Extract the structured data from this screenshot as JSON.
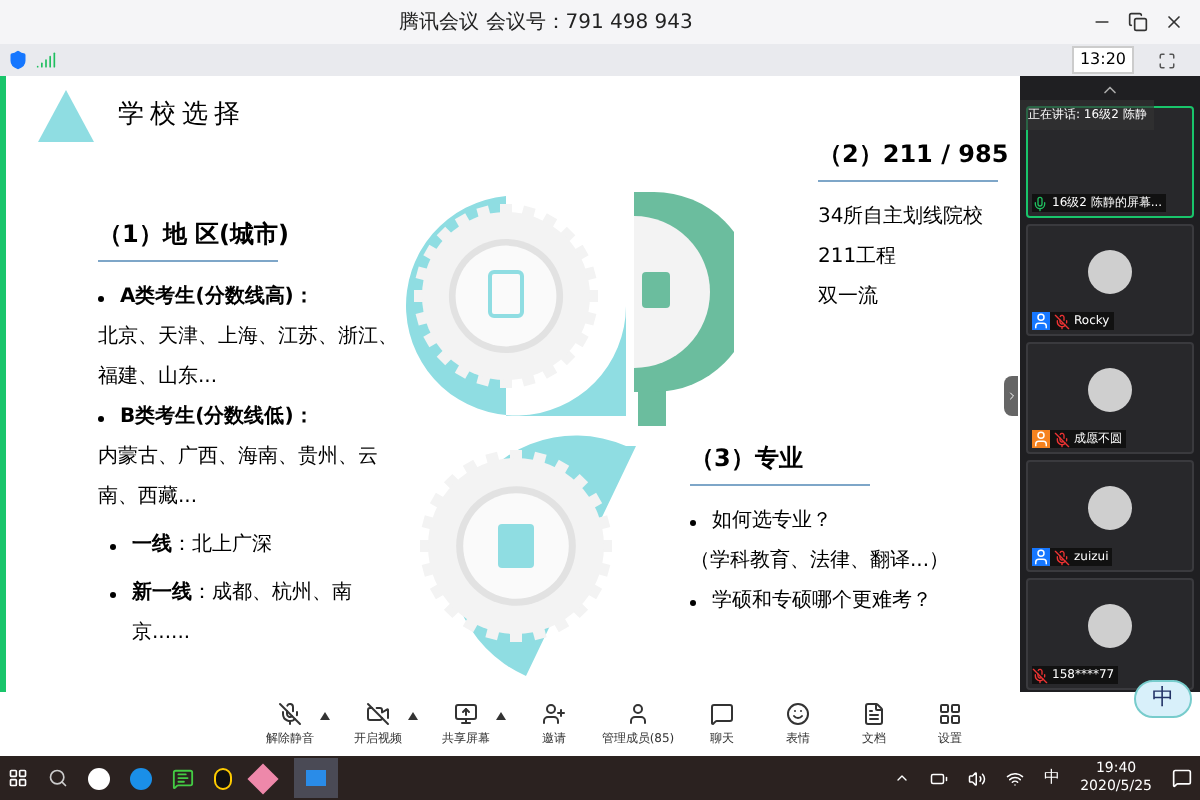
{
  "window": {
    "title": "腾讯会议 会议号：791 498 943",
    "timer": "13:20"
  },
  "slide": {
    "title": "学校选择",
    "sections": [
      {
        "heading": "（1）地 区(城市)",
        "items": [
          {
            "kind": "bullet",
            "text": "**A类考生(分数线高)：**"
          },
          {
            "kind": "line",
            "text": "北京、天津、上海、江苏、浙江、福建、山东..."
          },
          {
            "kind": "bullet",
            "text": "**B类考生(分数线低)：**"
          },
          {
            "kind": "line",
            "text": "内蒙古、广西、海南、贵州、云南、西藏..."
          },
          {
            "kind": "sub",
            "text": "**一线**：北上广深"
          },
          {
            "kind": "sub",
            "text": "**新一线**：成都、杭州、南京......"
          }
        ]
      },
      {
        "heading": "（2）211 / 985",
        "items": [
          {
            "kind": "line",
            "text": "34所自主划线院校"
          },
          {
            "kind": "line",
            "text": "211工程"
          },
          {
            "kind": "line",
            "text": "双一流"
          }
        ]
      },
      {
        "heading": "（3）专业",
        "items": [
          {
            "kind": "bullet",
            "text": "如何选专业？"
          },
          {
            "kind": "line",
            "text": "（学科教育、法律、翻译...）"
          },
          {
            "kind": "bullet",
            "text": "学硕和专硕哪个更难考？"
          }
        ]
      }
    ]
  },
  "participants": {
    "speaking_label": "正在讲话: 16级2 陈静",
    "items": [
      {
        "name": "16级2 陈静的屏幕...",
        "speaking": true,
        "muted": false
      },
      {
        "name": "Rocky",
        "speaking": false,
        "muted": true,
        "color": "#1677ff"
      },
      {
        "name": "成愿不圆",
        "speaking": false,
        "muted": true,
        "color": "#f5821f"
      },
      {
        "name": "zuizui",
        "speaking": false,
        "muted": true,
        "color": "#1677ff"
      },
      {
        "name": "158****77",
        "speaking": false,
        "muted": true
      }
    ]
  },
  "toolbar": [
    {
      "kind": "mic",
      "label": "解除静音",
      "has_menu": true
    },
    {
      "kind": "video",
      "label": "开启视频",
      "has_menu": true
    },
    {
      "kind": "share",
      "label": "共享屏幕",
      "has_menu": true
    },
    {
      "kind": "invite",
      "label": "邀请",
      "has_menu": false
    },
    {
      "kind": "members",
      "label": "管理成员(85)",
      "has_menu": false
    },
    {
      "kind": "chat",
      "label": "聊天",
      "has_menu": false
    },
    {
      "kind": "emoji",
      "label": "表情",
      "has_menu": false
    },
    {
      "kind": "docs",
      "label": "文档",
      "has_menu": false
    },
    {
      "kind": "settings",
      "label": "设置",
      "has_menu": false
    }
  ],
  "ime_badge": "中",
  "taskbar": {
    "ime": "中",
    "time": "19:40",
    "date": "2020/5/25"
  }
}
